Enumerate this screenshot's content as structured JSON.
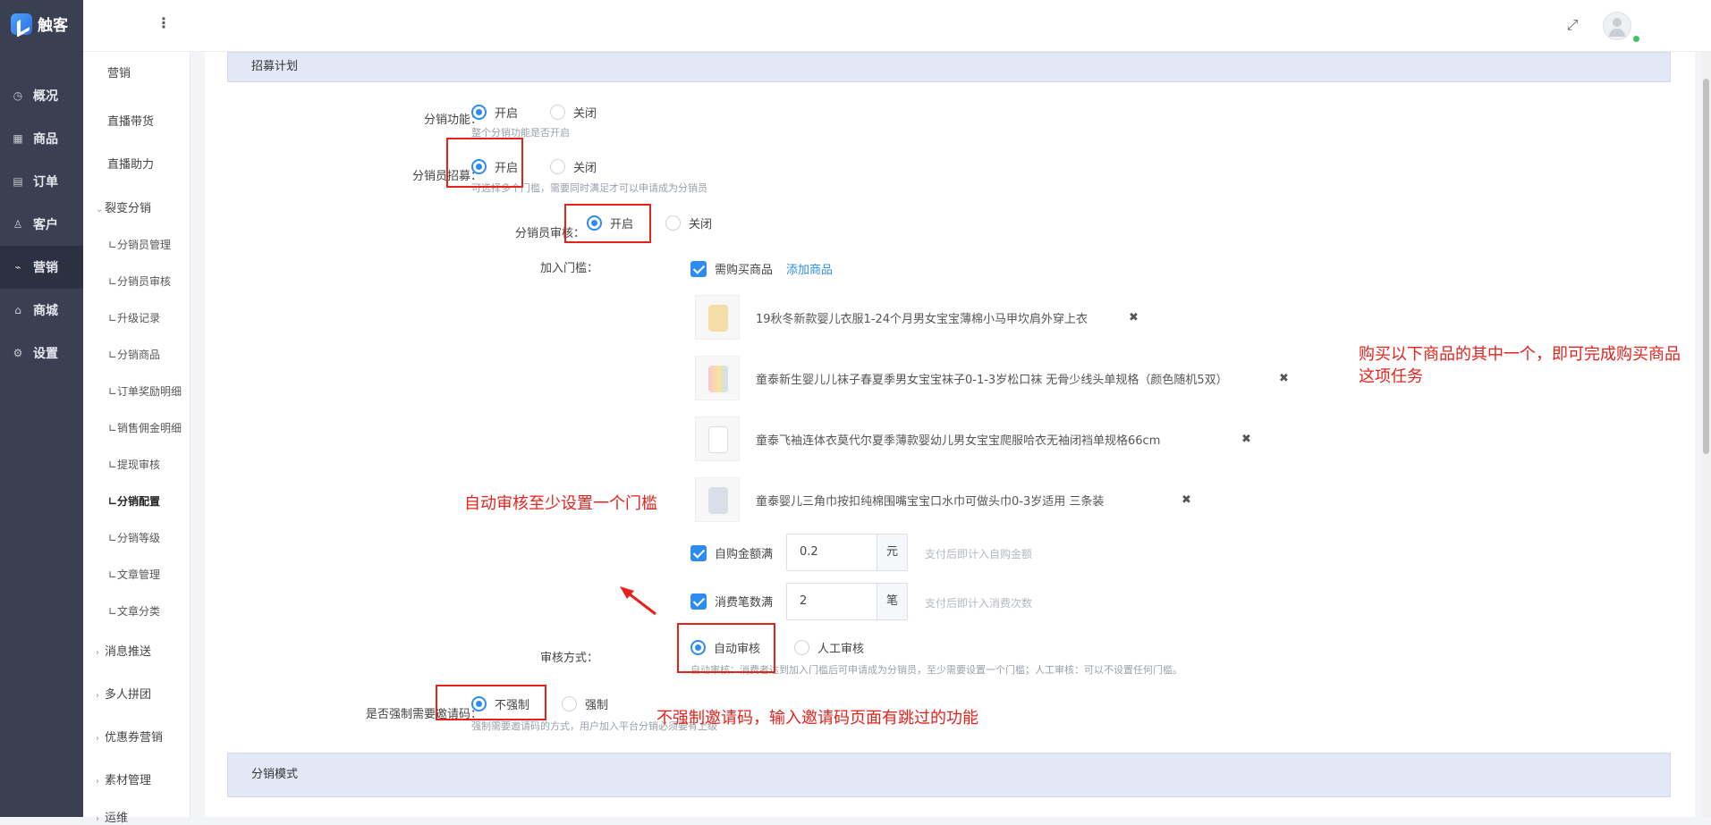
{
  "brand": {
    "name": "触客"
  },
  "main_nav": [
    {
      "label": "概况",
      "icon": "dashboard-icon"
    },
    {
      "label": "商品",
      "icon": "grid-icon"
    },
    {
      "label": "订单",
      "icon": "calendar-icon"
    },
    {
      "label": "客户",
      "icon": "user-icon"
    },
    {
      "label": "营销",
      "icon": "tag-icon"
    },
    {
      "label": "商城",
      "icon": "shop-icon"
    },
    {
      "label": "设置",
      "icon": "gear-icon"
    }
  ],
  "sub_nav": {
    "top": [
      "营销",
      "直播带货",
      "直播助力"
    ],
    "group": "裂变分销",
    "children": [
      "∟分销员管理",
      "∟分销员审核",
      "∟升级记录",
      "∟分销商品",
      "∟订单奖励明细",
      "∟销售佣金明细",
      "∟提现审核",
      "∟分销配置",
      "∟分销等级",
      "∟文章管理",
      "∟文章分类"
    ],
    "bottom_groups": [
      "消息推送",
      "多人拼团",
      "优惠券营销",
      "素材管理",
      "运维"
    ]
  },
  "sections": {
    "recruit": "招募计划",
    "mode": "分销模式"
  },
  "form": {
    "distribution": {
      "label": "分销功能：",
      "on": "开启",
      "off": "关闭",
      "hint": "整个分销功能是否开启"
    },
    "recruit": {
      "label": "分销员招募：",
      "on": "开启",
      "off": "关闭",
      "hint": "可选择多个门槛，需要同时满足才可以申请成为分销员"
    },
    "review": {
      "label": "分销员审核：",
      "on": "开启",
      "off": "关闭"
    },
    "threshold": {
      "label": "加入门槛：",
      "buy_goods": "需购买商品",
      "add_goods": "添加商品",
      "products": [
        "19秋冬新款婴儿衣服1-24个月男女宝宝薄棉小马甲坎肩外穿上衣",
        "童泰新生婴儿儿袜子春夏季男女宝宝袜子0-1-3岁松口袜 无骨少线头单规格（颜色随机5双）",
        "童泰飞袖连体衣莫代尔夏季薄款婴幼儿男女宝宝爬服哈衣无袖闭裆单规格66cm",
        "童泰婴儿三角巾按扣纯棉围嘴宝宝口水巾可做头巾0-3岁适用 三条装"
      ],
      "remove_icon": "✖",
      "self_amount": {
        "label": "自购金额满",
        "value": "0.2",
        "unit": "元",
        "hint": "支付后即计入自购金额"
      },
      "consume_count": {
        "label": "消费笔数满",
        "value": "2",
        "unit": "笔",
        "hint": "支付后即计入消费次数"
      }
    },
    "review_mode": {
      "label": "审核方式：",
      "auto": "自动审核",
      "manual": "人工审核",
      "hint": "自动审核：消费者达到加入门槛后可申请成为分销员，至少需要设置一个门槛；人工审核：可以不设置任何门槛。"
    },
    "invite": {
      "label": "是否强制需要邀请码：",
      "no_force": "不强制",
      "force": "强制",
      "hint": "强制需要邀请码的方式，用户加入平台分销必须要有上级"
    }
  },
  "annotations": {
    "products_note_1": "购买以下商品的其中一个，即可完成购买商品",
    "products_note_2": "这项任务",
    "auto_review_note": "自动审核至少设置一个门槛",
    "invite_note": "不强制邀请码，输入邀请码页面有跳过的功能"
  },
  "colors": {
    "primary": "#2d8cf0",
    "annotation_red": "#e4231c",
    "sidebar": "#3a3f51",
    "section_bg": "#e2e8f6"
  }
}
